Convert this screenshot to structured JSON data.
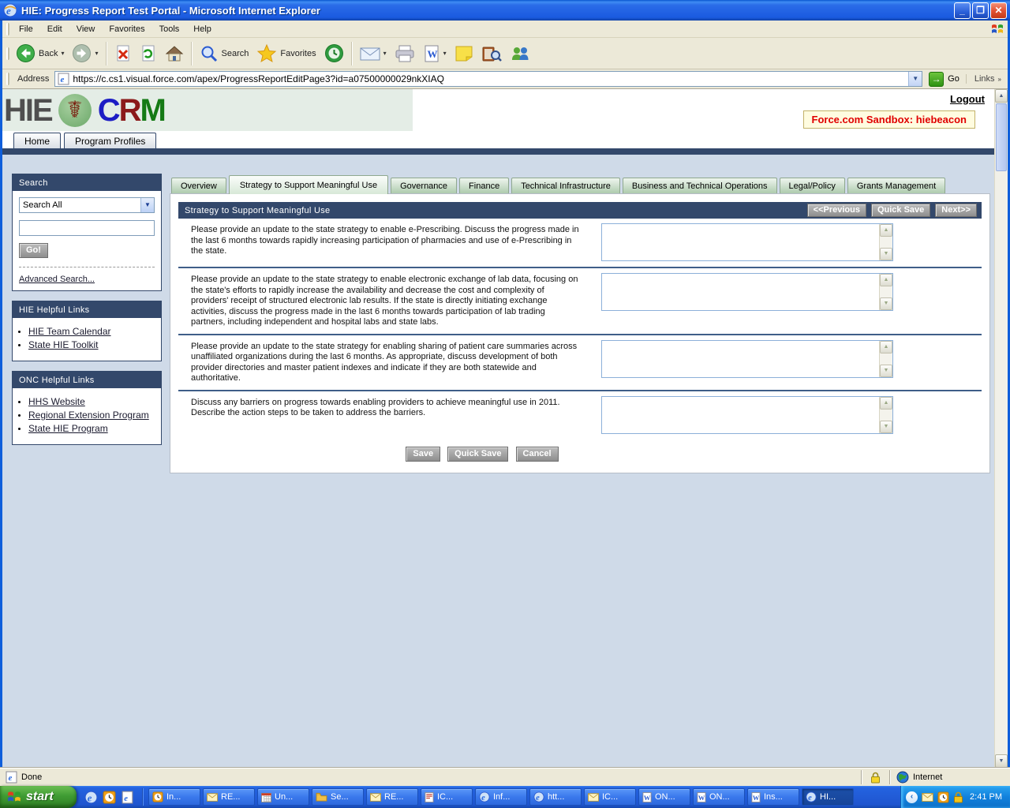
{
  "window": {
    "title": "HIE: Progress Report Test Portal - Microsoft Internet Explorer"
  },
  "menu": {
    "items": [
      "File",
      "Edit",
      "View",
      "Favorites",
      "Tools",
      "Help"
    ]
  },
  "toolbar": {
    "back_label": "Back",
    "search_label": "Search",
    "favorites_label": "Favorites"
  },
  "address": {
    "label": "Address",
    "url": "https://c.cs1.visual.force.com/apex/ProgressReportEditPage3?id=a07500000029nkXIAQ",
    "go_label": "Go",
    "links_label": "Links"
  },
  "header": {
    "logo_hie": "HIE",
    "logo_c": "C",
    "logo_r": "R",
    "logo_m": "M",
    "logout": "Logout",
    "sandbox": "Force.com Sandbox: hiebeacon"
  },
  "nav_tabs": {
    "home": "Home",
    "program_profiles": "Program Profiles"
  },
  "sidebar": {
    "search_title": "Search",
    "search_scope": "Search All",
    "go_label": "Go!",
    "advanced": "Advanced Search...",
    "hie_title": "HIE Helpful Links",
    "hie_links": [
      "HIE Team Calendar",
      "State HIE Toolkit"
    ],
    "onc_title": "ONC Helpful Links",
    "onc_links": [
      "HHS Website",
      "Regional Extension Program",
      "State HIE Program"
    ]
  },
  "main": {
    "tabs": [
      "Overview",
      "Strategy to Support Meaningful Use",
      "Governance",
      "Finance",
      "Technical Infrastructure",
      "Business and Technical Operations",
      "Legal/Policy",
      "Grants Management"
    ],
    "selected_tab": "Strategy to Support Meaningful Use",
    "section_title": "Strategy to Support Meaningful Use",
    "prev_label": "<<Previous",
    "quicksave_label": "Quick Save",
    "next_label": "Next>>",
    "questions": [
      "Please provide an update to the state strategy to enable e-Prescribing. Discuss the progress made in the last 6 months towards rapidly increasing participation of pharmacies and use of e-Prescribing in the state.",
      "Please provide an update to the state strategy to enable electronic exchange of lab data, focusing on the state's efforts to rapidly increase the availability and decrease the cost and complexity of providers' receipt of structured electronic lab results. If the state is directly initiating exchange activities, discuss the progress made in the last 6 months towards participation of lab trading partners, including independent and hospital labs and state labs.",
      "Please provide an update to the state strategy for enabling sharing of patient care summaries across unaffiliated organizations during the last 6 months. As appropriate, discuss development of both provider directories and master patient indexes and indicate if they are both statewide and authoritative.",
      "Discuss any barriers on progress towards enabling providers to achieve meaningful use in 2011. Describe the action steps to be taken to address the barriers."
    ],
    "save_label": "Save",
    "cancel_label": "Cancel"
  },
  "statusbar": {
    "status": "Done",
    "zone": "Internet"
  },
  "taskbar": {
    "start_label": "start",
    "tasks": [
      {
        "label": "In..."
      },
      {
        "label": "RE..."
      },
      {
        "label": "Un..."
      },
      {
        "label": "Se..."
      },
      {
        "label": "RE..."
      },
      {
        "label": "IC..."
      },
      {
        "label": "Inf..."
      },
      {
        "label": "htt..."
      },
      {
        "label": "IC..."
      },
      {
        "label": "ON..."
      },
      {
        "label": "ON..."
      },
      {
        "label": "Ins..."
      },
      {
        "label": "HI..."
      }
    ],
    "time": "2:41 PM"
  },
  "colors": {
    "navy": "#33486B",
    "tab_green": "#AECBAE",
    "sandbox_red": "#E00000",
    "taskbar_blue": "#2463E0"
  }
}
